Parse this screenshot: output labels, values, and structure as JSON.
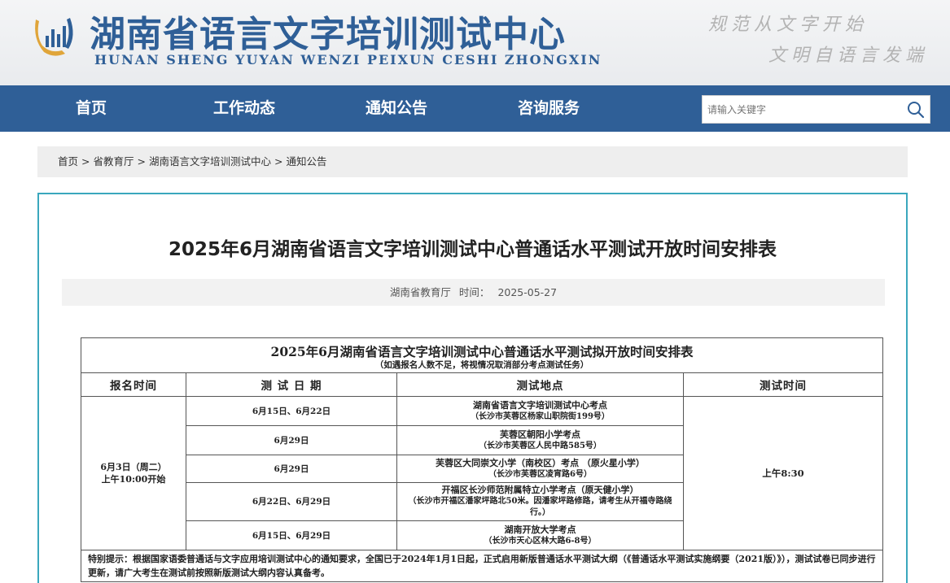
{
  "header": {
    "title": "湖南省语言文字培训测试中心",
    "pinyin": "HUNAN SHENG YUYAN WENZI PEIXUN CESHI ZHONGXIN",
    "slogan_1": "规范从文字开始",
    "slogan_2": "文明自语言发端"
  },
  "nav": {
    "items": [
      {
        "label": "首页"
      },
      {
        "label": "工作动态"
      },
      {
        "label": "通知公告"
      },
      {
        "label": "咨询服务"
      }
    ],
    "search": {
      "placeholder": "请输入关键字"
    }
  },
  "breadcrumb": [
    "首页",
    "省教育厅",
    "湖南语言文字培训测试中心",
    "通知公告"
  ],
  "article": {
    "title": "2025年6月湖南省语言文字培训测试中心普通话水平测试开放时间安排表",
    "source": "湖南省教育厅",
    "time_label": "时间：",
    "time": "2025-05-27"
  },
  "schedule": {
    "caption": "2025年6月湖南省语言文字培训测试中心普通话水平测试拟开放时间安排表",
    "subcaption": "（如遇报名人数不足，将视情况取消部分考点测试任务）",
    "headers": [
      "报名时间",
      "测  试  日  期",
      "测试地点",
      "测试时间"
    ],
    "registration": "6月3日（周二）",
    "registration_time": "上午10:00开始",
    "test_time": "上午8:30",
    "rows": [
      {
        "date": "6月15日、6月22日",
        "site": "湖南省语言文字培训测试中心考点",
        "address": "（长沙市芙蓉区杨家山职院街199号）"
      },
      {
        "date": "6月29日",
        "site": "芙蓉区朝阳小学考点",
        "address": "（长沙市芙蓉区人民中路585号）"
      },
      {
        "date": "6月29日",
        "site": "芙蓉区大同崇文小学（南校区）考点 （原火星小学）",
        "address": "（长沙市芙蓉区凌宵路6号）"
      },
      {
        "date": "6月22日、6月29日",
        "site": "开福区长沙师范附属特立小学考点（原天健小学）",
        "address": "（长沙市开福区潘家坪路北50米。因潘家坪路修路，请考生从开福寺路绕行。）"
      },
      {
        "date": "6月15日、6月29日",
        "site": "湖南开放大学考点",
        "address": "（长沙市天心区林大路6-8号）"
      }
    ],
    "notice": "特别提示：根据国家语委普通话与文字应用培训测试中心的通知要求，全国已于2024年1月1日起，正式启用新版普通话水平测试大纲（《普通话水平测试实施纲要（2021版）》），测试试卷已同步进行更新，请广大考生在测试前按照新版测试大纲内容认真备考。"
  },
  "colors": {
    "brand": "#2f5f97",
    "border_accent": "#3aa7bd"
  }
}
